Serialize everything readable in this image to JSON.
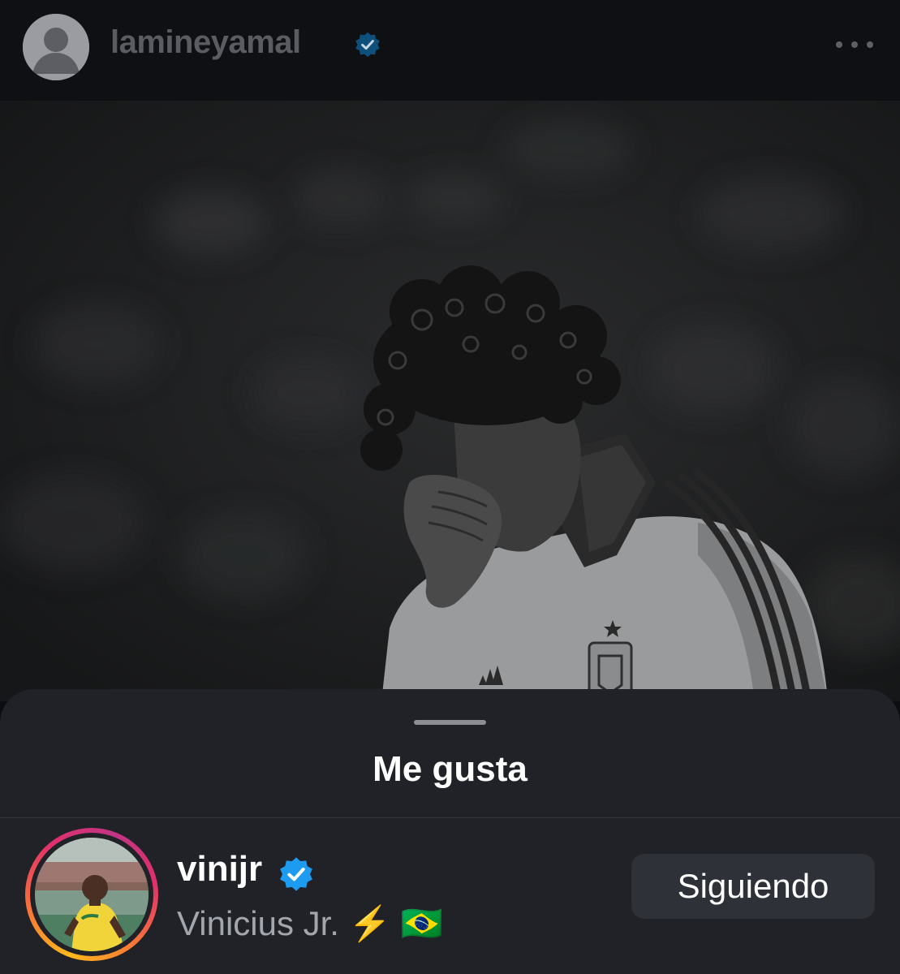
{
  "post_header": {
    "username": "lamineyamal",
    "verified_icon": "verified-badge-icon",
    "more_icon": "more-horizontal-icon",
    "avatar": "default-avatar-icon"
  },
  "photo": {
    "description_icon": "post-photo"
  },
  "likes_sheet": {
    "title": "Me gusta",
    "likers": [
      {
        "username": "vinijr",
        "display_name": "Vinicius Jr. ⚡️ 🇧🇷",
        "verified": true,
        "follow_state": "Siguiendo"
      }
    ]
  },
  "colors": {
    "background": "#0c0d10",
    "sheet": "#202228",
    "verified_blue": "#1d9bf0",
    "button": "#2e3138"
  }
}
